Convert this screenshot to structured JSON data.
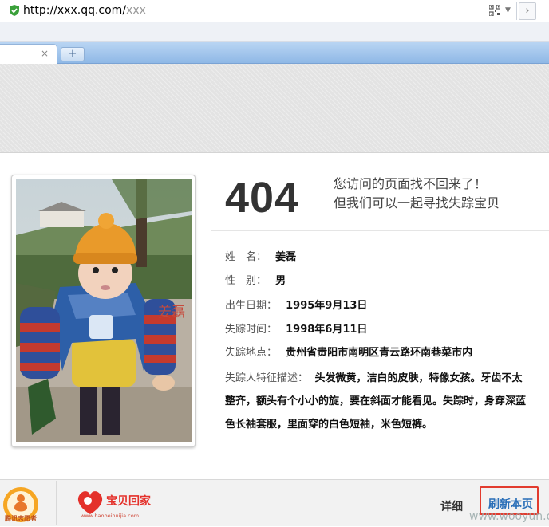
{
  "browser": {
    "url_prefix": "http://xxx.qq.com/",
    "url_suffix": "xxx",
    "tab_close": "×",
    "new_tab": "+",
    "forward": "›"
  },
  "page": {
    "code": "404",
    "message_line1": "您访问的页面找不回来了！",
    "message_line2": "但我们可以一起寻找失踪宝贝",
    "photo_caption": "姜磊",
    "fields": [
      {
        "label": "姓　名：",
        "value": "姜磊"
      },
      {
        "label": "性　别：",
        "value": "男"
      },
      {
        "label": "出生日期：",
        "value": "1995年9月13日"
      },
      {
        "label": "失踪时间：",
        "value": "1998年6月11日"
      },
      {
        "label": "失踪地点：",
        "value": "贵州省贵阳市南明区青云路环南巷菜市内"
      }
    ],
    "desc_label": "失踪人特征描述：",
    "desc_text": "头发微黄，洁白的皮肤，特像女孩。牙齿不太整齐，额头有个小小的旋，要在斜面才能看见。失踪时，身穿深蓝色长袖套服，里面穿的白色短袖，米色短裤。"
  },
  "footer": {
    "logo1_text": "腾讯志愿者",
    "logo2_text": "宝贝回家",
    "logo2_url": "www.baobeihuijia.com",
    "detail_label": "详细",
    "refresh_label": "刷新本页",
    "watermark": "www.wooyun.org"
  },
  "colors": {
    "tabbar": "#a9c9ee",
    "banner": "#e3e3e3",
    "refresh_border": "#e23b2e",
    "refresh_text": "#2a6fb8"
  }
}
